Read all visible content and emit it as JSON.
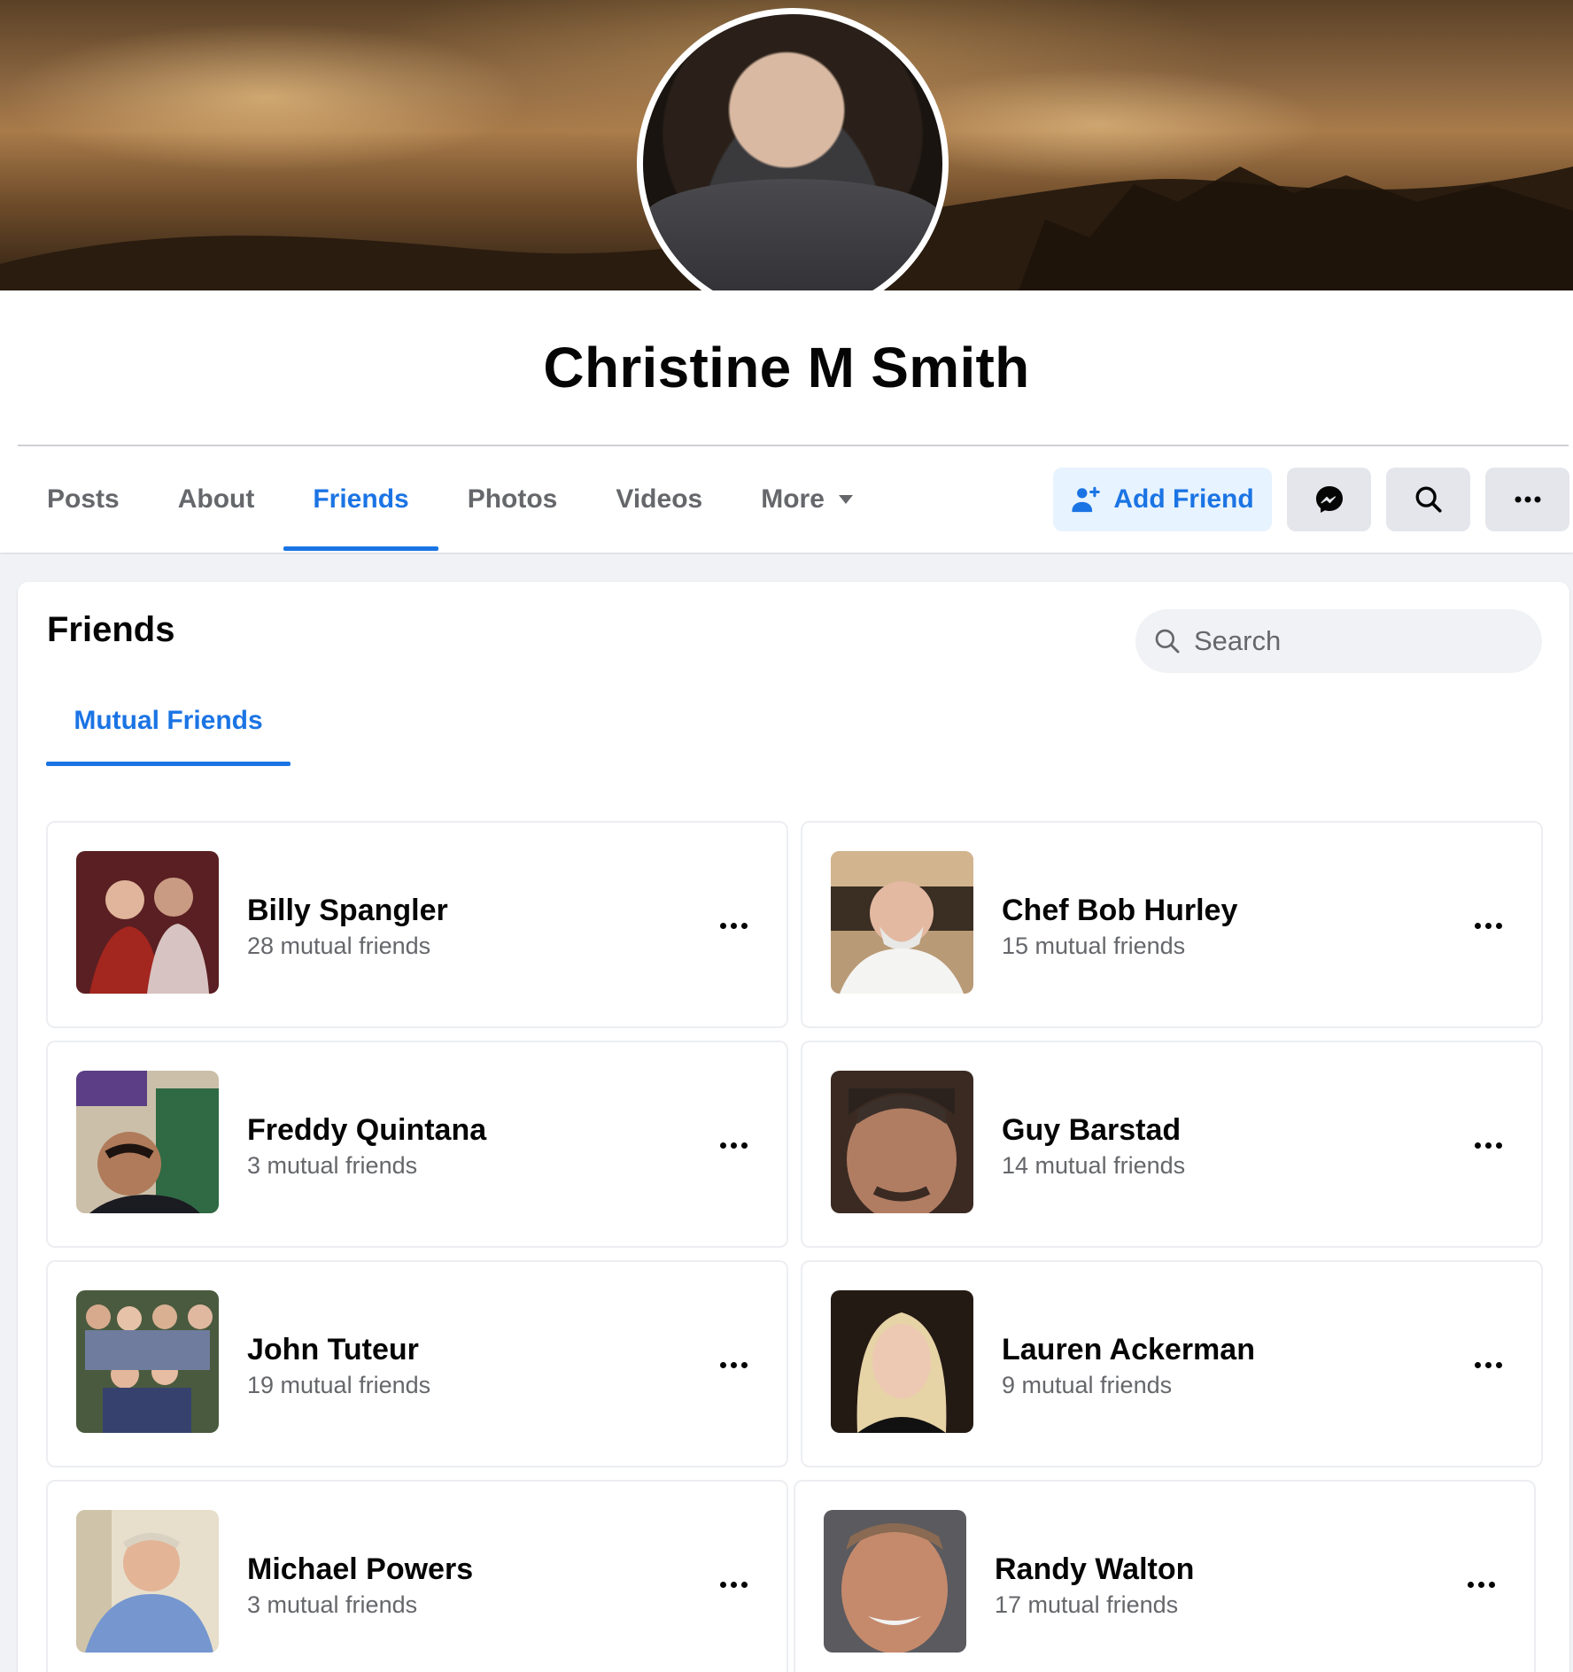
{
  "profile": {
    "name": "Christine M Smith"
  },
  "nav": {
    "tabs": [
      {
        "label": "Posts"
      },
      {
        "label": "About"
      },
      {
        "label": "Friends"
      },
      {
        "label": "Photos"
      },
      {
        "label": "Videos"
      },
      {
        "label": "More"
      }
    ],
    "active_tab": "Friends",
    "add_friend_label": "Add Friend",
    "icons": {
      "add_friend": "person-add-icon",
      "messenger": "messenger-icon",
      "search": "search-icon",
      "more": "more-dots-icon",
      "dropdown": "caret-down-icon"
    }
  },
  "friends_panel": {
    "title": "Friends",
    "search_placeholder": "Search",
    "subtab": "Mutual Friends",
    "friends": [
      {
        "name": "Billy Spangler",
        "mutual": "28 mutual friends"
      },
      {
        "name": "Chef Bob Hurley",
        "mutual": "15 mutual friends"
      },
      {
        "name": "Freddy Quintana",
        "mutual": "3 mutual friends"
      },
      {
        "name": "Guy Barstad",
        "mutual": "14 mutual friends"
      },
      {
        "name": "John Tuteur",
        "mutual": "19 mutual friends"
      },
      {
        "name": "Lauren Ackerman",
        "mutual": "9 mutual friends"
      },
      {
        "name": "Michael Powers",
        "mutual": "3 mutual friends"
      },
      {
        "name": "Randy Walton",
        "mutual": "17 mutual friends"
      }
    ]
  },
  "colors": {
    "accent": "#1b74e4",
    "accent_light": "#e7f3ff",
    "secondary_text": "#65676b",
    "page_background": "#f0f2f5",
    "button_gray": "#e4e6eb"
  }
}
